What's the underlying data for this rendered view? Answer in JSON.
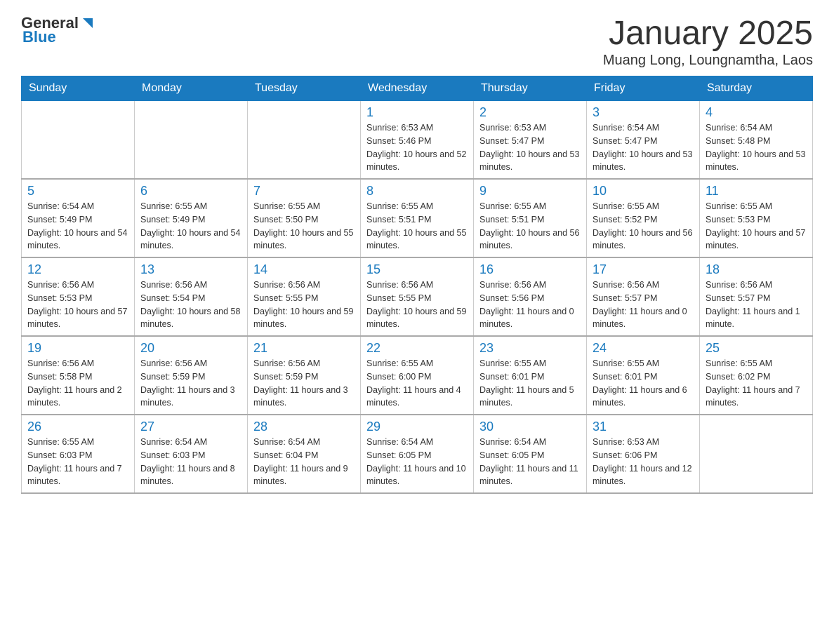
{
  "header": {
    "logo_general": "General",
    "logo_blue": "Blue",
    "month_title": "January 2025",
    "location": "Muang Long, Loungnamtha, Laos"
  },
  "days_of_week": [
    "Sunday",
    "Monday",
    "Tuesday",
    "Wednesday",
    "Thursday",
    "Friday",
    "Saturday"
  ],
  "weeks": [
    [
      {
        "day": "",
        "info": ""
      },
      {
        "day": "",
        "info": ""
      },
      {
        "day": "",
        "info": ""
      },
      {
        "day": "1",
        "info": "Sunrise: 6:53 AM\nSunset: 5:46 PM\nDaylight: 10 hours and 52 minutes."
      },
      {
        "day": "2",
        "info": "Sunrise: 6:53 AM\nSunset: 5:47 PM\nDaylight: 10 hours and 53 minutes."
      },
      {
        "day": "3",
        "info": "Sunrise: 6:54 AM\nSunset: 5:47 PM\nDaylight: 10 hours and 53 minutes."
      },
      {
        "day": "4",
        "info": "Sunrise: 6:54 AM\nSunset: 5:48 PM\nDaylight: 10 hours and 53 minutes."
      }
    ],
    [
      {
        "day": "5",
        "info": "Sunrise: 6:54 AM\nSunset: 5:49 PM\nDaylight: 10 hours and 54 minutes."
      },
      {
        "day": "6",
        "info": "Sunrise: 6:55 AM\nSunset: 5:49 PM\nDaylight: 10 hours and 54 minutes."
      },
      {
        "day": "7",
        "info": "Sunrise: 6:55 AM\nSunset: 5:50 PM\nDaylight: 10 hours and 55 minutes."
      },
      {
        "day": "8",
        "info": "Sunrise: 6:55 AM\nSunset: 5:51 PM\nDaylight: 10 hours and 55 minutes."
      },
      {
        "day": "9",
        "info": "Sunrise: 6:55 AM\nSunset: 5:51 PM\nDaylight: 10 hours and 56 minutes."
      },
      {
        "day": "10",
        "info": "Sunrise: 6:55 AM\nSunset: 5:52 PM\nDaylight: 10 hours and 56 minutes."
      },
      {
        "day": "11",
        "info": "Sunrise: 6:55 AM\nSunset: 5:53 PM\nDaylight: 10 hours and 57 minutes."
      }
    ],
    [
      {
        "day": "12",
        "info": "Sunrise: 6:56 AM\nSunset: 5:53 PM\nDaylight: 10 hours and 57 minutes."
      },
      {
        "day": "13",
        "info": "Sunrise: 6:56 AM\nSunset: 5:54 PM\nDaylight: 10 hours and 58 minutes."
      },
      {
        "day": "14",
        "info": "Sunrise: 6:56 AM\nSunset: 5:55 PM\nDaylight: 10 hours and 59 minutes."
      },
      {
        "day": "15",
        "info": "Sunrise: 6:56 AM\nSunset: 5:55 PM\nDaylight: 10 hours and 59 minutes."
      },
      {
        "day": "16",
        "info": "Sunrise: 6:56 AM\nSunset: 5:56 PM\nDaylight: 11 hours and 0 minutes."
      },
      {
        "day": "17",
        "info": "Sunrise: 6:56 AM\nSunset: 5:57 PM\nDaylight: 11 hours and 0 minutes."
      },
      {
        "day": "18",
        "info": "Sunrise: 6:56 AM\nSunset: 5:57 PM\nDaylight: 11 hours and 1 minute."
      }
    ],
    [
      {
        "day": "19",
        "info": "Sunrise: 6:56 AM\nSunset: 5:58 PM\nDaylight: 11 hours and 2 minutes."
      },
      {
        "day": "20",
        "info": "Sunrise: 6:56 AM\nSunset: 5:59 PM\nDaylight: 11 hours and 3 minutes."
      },
      {
        "day": "21",
        "info": "Sunrise: 6:56 AM\nSunset: 5:59 PM\nDaylight: 11 hours and 3 minutes."
      },
      {
        "day": "22",
        "info": "Sunrise: 6:55 AM\nSunset: 6:00 PM\nDaylight: 11 hours and 4 minutes."
      },
      {
        "day": "23",
        "info": "Sunrise: 6:55 AM\nSunset: 6:01 PM\nDaylight: 11 hours and 5 minutes."
      },
      {
        "day": "24",
        "info": "Sunrise: 6:55 AM\nSunset: 6:01 PM\nDaylight: 11 hours and 6 minutes."
      },
      {
        "day": "25",
        "info": "Sunrise: 6:55 AM\nSunset: 6:02 PM\nDaylight: 11 hours and 7 minutes."
      }
    ],
    [
      {
        "day": "26",
        "info": "Sunrise: 6:55 AM\nSunset: 6:03 PM\nDaylight: 11 hours and 7 minutes."
      },
      {
        "day": "27",
        "info": "Sunrise: 6:54 AM\nSunset: 6:03 PM\nDaylight: 11 hours and 8 minutes."
      },
      {
        "day": "28",
        "info": "Sunrise: 6:54 AM\nSunset: 6:04 PM\nDaylight: 11 hours and 9 minutes."
      },
      {
        "day": "29",
        "info": "Sunrise: 6:54 AM\nSunset: 6:05 PM\nDaylight: 11 hours and 10 minutes."
      },
      {
        "day": "30",
        "info": "Sunrise: 6:54 AM\nSunset: 6:05 PM\nDaylight: 11 hours and 11 minutes."
      },
      {
        "day": "31",
        "info": "Sunrise: 6:53 AM\nSunset: 6:06 PM\nDaylight: 11 hours and 12 minutes."
      },
      {
        "day": "",
        "info": ""
      }
    ]
  ]
}
